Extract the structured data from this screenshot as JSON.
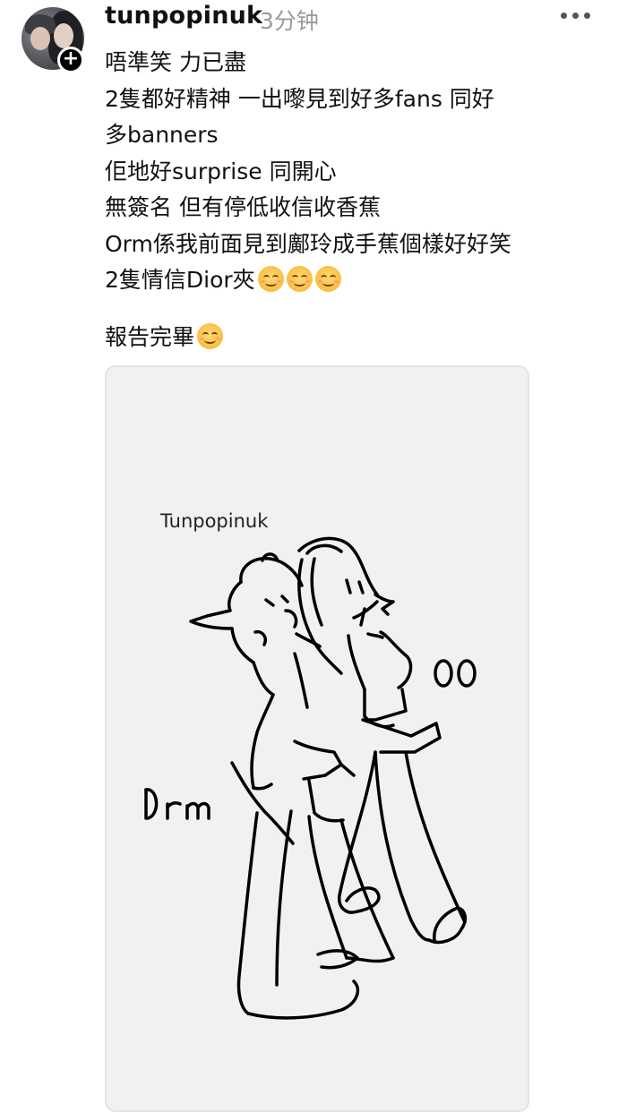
{
  "post": {
    "username": "tunpopinuk",
    "time": "3分钟",
    "follow_icon": "plus-icon",
    "more_icon": "more-dots-icon",
    "lines": [
      "唔準笑 力已盡",
      "2隻都好精神 一出嚟見到好多fans 同好",
      "多banners",
      "佢地好surprise 同開心",
      "無簽名 但有停低收信收香蕉",
      "Orm係我前面見到鄺玲成手蕉個樣好好笑",
      "2隻情信Dior夾"
    ],
    "last_line": "報告完畢",
    "emoji_icon": "smiling-face-icon"
  },
  "drawing": {
    "signature": "Tunpopinuk",
    "label_left": "Orm",
    "label_right": "OO"
  }
}
